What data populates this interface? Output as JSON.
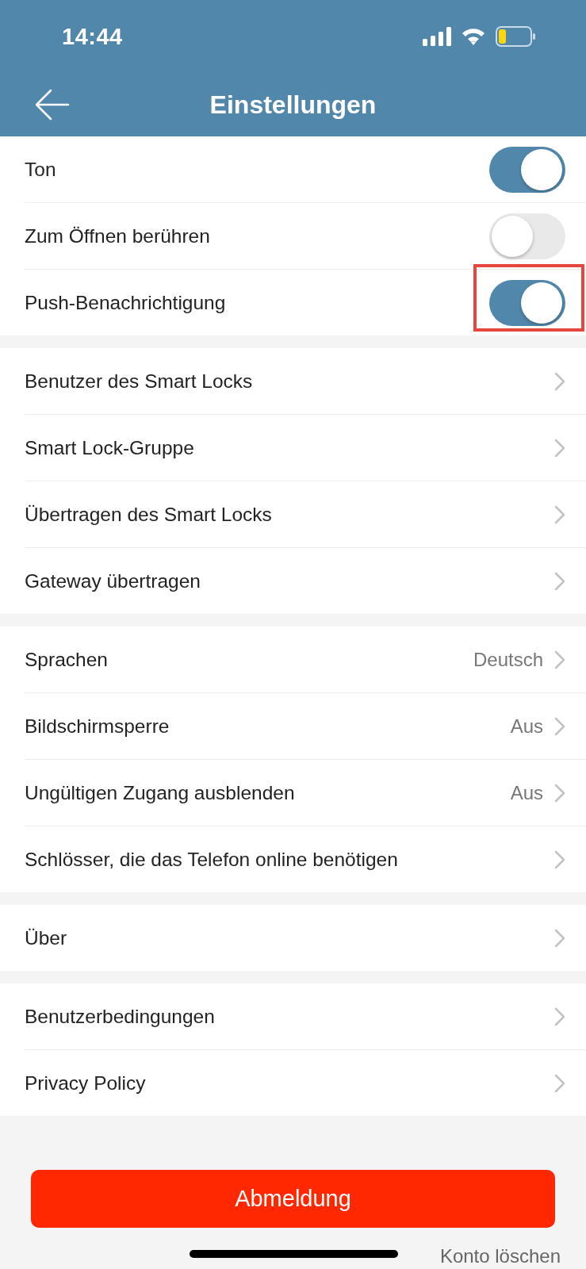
{
  "status_bar": {
    "time": "14:44"
  },
  "header": {
    "title": "Einstellungen"
  },
  "sections": [
    {
      "items": [
        {
          "kind": "toggle",
          "label": "Ton",
          "on": true,
          "highlighted": false
        },
        {
          "kind": "toggle",
          "label": "Zum Öffnen berühren",
          "on": false,
          "highlighted": false
        },
        {
          "kind": "toggle",
          "label": "Push-Benachrichtigung",
          "on": true,
          "highlighted": true
        }
      ]
    },
    {
      "items": [
        {
          "kind": "link",
          "label": "Benutzer des Smart Locks"
        },
        {
          "kind": "link",
          "label": "Smart Lock-Gruppe"
        },
        {
          "kind": "link",
          "label": "Übertragen des Smart Locks"
        },
        {
          "kind": "link",
          "label": "Gateway übertragen"
        }
      ]
    },
    {
      "items": [
        {
          "kind": "link",
          "label": "Sprachen",
          "value": "Deutsch"
        },
        {
          "kind": "link",
          "label": "Bildschirmsperre",
          "value": "Aus"
        },
        {
          "kind": "link",
          "label": "Ungültigen Zugang ausblenden",
          "value": "Aus"
        },
        {
          "kind": "link",
          "label": "Schlösser, die das Telefon online benötigen"
        }
      ]
    },
    {
      "items": [
        {
          "kind": "link",
          "label": "Über"
        }
      ]
    },
    {
      "items": [
        {
          "kind": "link",
          "label": "Benutzerbedingungen"
        },
        {
          "kind": "link",
          "label": "Privacy Policy"
        }
      ]
    }
  ],
  "logout_button": "Abmeldung",
  "delete_account_link": "Konto löschen"
}
